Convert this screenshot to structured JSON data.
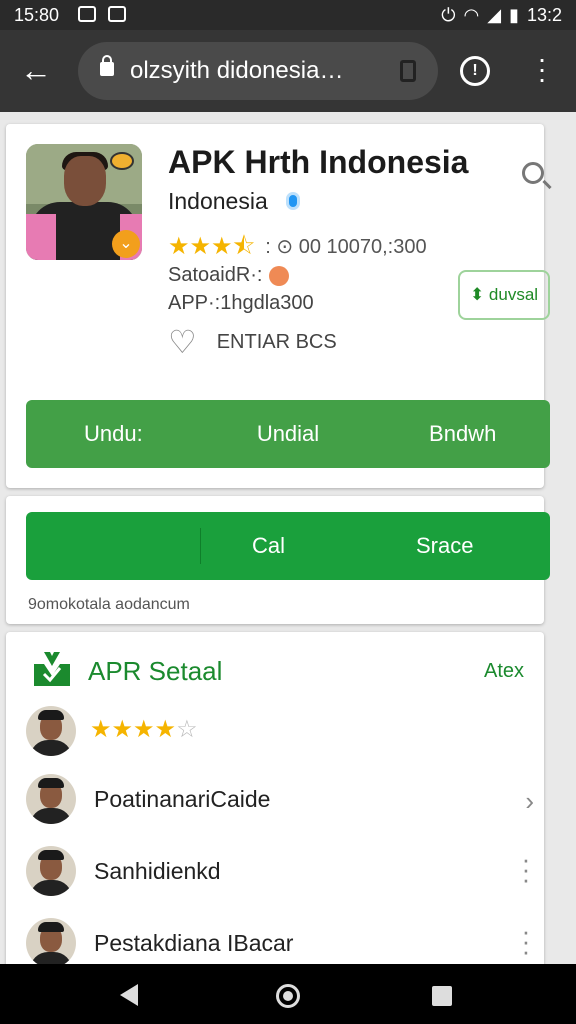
{
  "status_bar": {
    "time": "15:80",
    "right_time": "13:2"
  },
  "browser": {
    "url": "olzsyith didonesia…",
    "icons": [
      "back-arrow-icon",
      "lock-icon",
      "tabs-icon",
      "alert-icon",
      "more-vert-icon"
    ]
  },
  "app": {
    "title": "APK Hrth Indonesia",
    "developer": "Indonesia",
    "rating_stars": 3.5,
    "rating_text": ": ⊙ 00 10070,:300",
    "meta_line1": "SatoaidR·:",
    "meta_line2": "APP·:1hgdla300",
    "install_small": "⬍ duvsal",
    "wishlist": "ENTIAR BCS",
    "buttons": [
      "Undu:",
      "Undial",
      "Bndwh"
    ]
  },
  "actions": {
    "left_label": "Cal",
    "right_label": "Srace",
    "note": "9omokotala aodancum"
  },
  "section": {
    "title": "APR Setaal",
    "link": "Atex",
    "rows": [
      {
        "type": "stars",
        "stars": 4
      },
      {
        "type": "label",
        "label": "PoatinanariCaide",
        "trail": "chevron"
      },
      {
        "type": "label",
        "label": "Sanhidienkd",
        "trail": "kebab"
      },
      {
        "type": "label",
        "label": "Pestakdiana IBacar",
        "trail": "kebab"
      }
    ]
  },
  "colors": {
    "primary_green": "#43a047",
    "action_green": "#1aa03c",
    "title_green": "#1b8a2e",
    "star": "#f5b400"
  }
}
